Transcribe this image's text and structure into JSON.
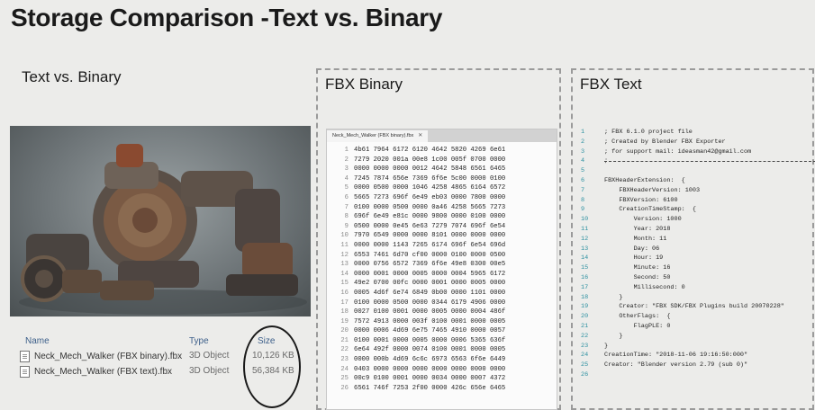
{
  "slide": {
    "title": "Storage Comparison -Text vs. Binary"
  },
  "left": {
    "heading": "Text vs. Binary",
    "table": {
      "headers": {
        "name": "Name",
        "type": "Type",
        "size": "Size"
      },
      "rows": [
        {
          "name": "Neck_Mech_Walker (FBX binary).fbx",
          "type": "3D Object",
          "size": "10,126 KB"
        },
        {
          "name": "Neck_Mech_Walker (FBX text).fbx",
          "type": "3D Object",
          "size": "56,384 KB"
        }
      ]
    }
  },
  "binary_panel": {
    "heading": "FBX Binary",
    "tab_label": "Neck_Mech_Walker (FBX binary).fbx",
    "lines": [
      {
        "n": "1",
        "hex": "4b61 7964 6172 6120 4642 5820 4269 6e61"
      },
      {
        "n": "2",
        "hex": "7279 2020 001a 00e8 1c00 005f 0700 0000"
      },
      {
        "n": "3",
        "hex": "0000 0000 0000 0012 4642 5848 6561 6465"
      },
      {
        "n": "4",
        "hex": "7245 7874 656e 7369 6f6e 5c00 0000 0100"
      },
      {
        "n": "5",
        "hex": "0000 0500 0000 1046 4258 4865 6164 6572"
      },
      {
        "n": "6",
        "hex": "5665 7273 696f 6e49 eb03 0000 7800 0000"
      },
      {
        "n": "7",
        "hex": "0100 0000 0500 0000 0a46 4258 5665 7273"
      },
      {
        "n": "8",
        "hex": "696f 6e49 e81c 0000 9800 0000 0100 0000"
      },
      {
        "n": "9",
        "hex": "0500 0000 0e45 6e63 7279 7074 696f 6e54"
      },
      {
        "n": "10",
        "hex": "7970 6549 0000 0000 8101 0000 0000 0000"
      },
      {
        "n": "11",
        "hex": "0000 0000 1143 7265 6174 696f 6e54 696d"
      },
      {
        "n": "12",
        "hex": "6553 7461 6d70 cf00 0000 0100 0000 0500"
      },
      {
        "n": "13",
        "hex": "0000 0756 6572 7369 6f6e 49e8 0300 00e5"
      },
      {
        "n": "14",
        "hex": "0000 0001 0000 0005 0000 0004 5965 6172"
      },
      {
        "n": "15",
        "hex": "49e2 0700 00fc 0000 0001 0000 0005 0000"
      },
      {
        "n": "16",
        "hex": "0005 4d6f 6e74 6849 0b00 0000 1101 0000"
      },
      {
        "n": "17",
        "hex": "0100 0000 0500 0000 0344 6179 4906 0000"
      },
      {
        "n": "18",
        "hex": "0027 0100 0001 0000 0005 0000 0004 486f"
      },
      {
        "n": "19",
        "hex": "7572 4913 0000 003f 0100 0001 0000 0005"
      },
      {
        "n": "20",
        "hex": "0000 0006 4d69 6e75 7465 4910 0000 0057"
      },
      {
        "n": "21",
        "hex": "0100 0001 0000 0005 0000 0006 5365 636f"
      },
      {
        "n": "22",
        "hex": "6e64 492f 0000 0074 0100 0001 0000 0005"
      },
      {
        "n": "23",
        "hex": "0000 000b 4d69 6c6c 6973 6563 6f6e 6449"
      },
      {
        "n": "24",
        "hex": "0403 0000 0000 0000 0000 0000 0000 0000"
      },
      {
        "n": "25",
        "hex": "00c9 0100 0001 0000 0034 0000 0007 4372"
      },
      {
        "n": "26",
        "hex": "6561 746f 7253 2f00 0000 426c 656e 6465"
      }
    ]
  },
  "text_panel": {
    "heading": "FBX Text",
    "lines": [
      {
        "n": "1",
        "t": "; FBX 6.1.0 project file"
      },
      {
        "n": "2",
        "t": "; Created by Blender FBX Exporter"
      },
      {
        "n": "3",
        "t": "; for support mail: ideasman42@gmail.com"
      },
      {
        "n": "4",
        "t": "; ",
        "sep": true
      },
      {
        "n": "5",
        "t": ""
      },
      {
        "n": "6",
        "t": "FBXHeaderExtension:  {"
      },
      {
        "n": "7",
        "t": "    FBXHeaderVersion: 1003"
      },
      {
        "n": "8",
        "t": "    FBXVersion: 6100"
      },
      {
        "n": "9",
        "t": "    CreationTimeStamp:  {"
      },
      {
        "n": "10",
        "t": "        Version: 1000"
      },
      {
        "n": "11",
        "t": "        Year: 2018"
      },
      {
        "n": "12",
        "t": "        Month: 11"
      },
      {
        "n": "13",
        "t": "        Day: 06"
      },
      {
        "n": "14",
        "t": "        Hour: 19"
      },
      {
        "n": "15",
        "t": "        Minute: 16"
      },
      {
        "n": "16",
        "t": "        Second: 50"
      },
      {
        "n": "17",
        "t": "        Millisecond: 0"
      },
      {
        "n": "18",
        "t": "    }"
      },
      {
        "n": "19",
        "t": "    Creator: \"FBX SDK/FBX Plugins build 20070228\""
      },
      {
        "n": "20",
        "t": "    OtherFlags:  {"
      },
      {
        "n": "21",
        "t": "        FlagPLE: 0"
      },
      {
        "n": "22",
        "t": "    }"
      },
      {
        "n": "23",
        "t": "}"
      },
      {
        "n": "24",
        "t": "CreationTime: \"2018-11-06 19:16:50:000\""
      },
      {
        "n": "25",
        "t": "Creator: \"Blender version 2.79 (sub 0)\""
      },
      {
        "n": "26",
        "t": ""
      }
    ]
  }
}
